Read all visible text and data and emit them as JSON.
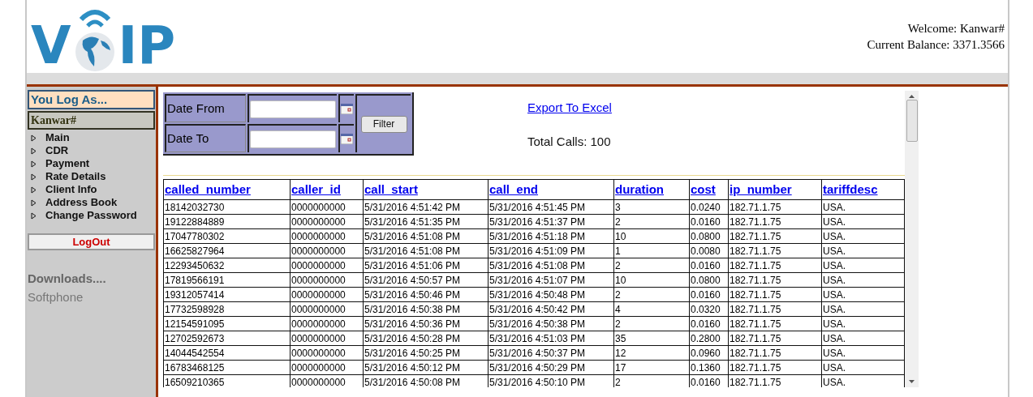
{
  "logo": {
    "left": "V",
    "right": "IP"
  },
  "header": {
    "welcome": "Welcome: Kanwar#",
    "balance": "Current Balance: 3371.3566"
  },
  "sidebar": {
    "title": "You Log As...",
    "user": "Kanwar#",
    "menu": [
      "Main",
      "CDR",
      "Payment",
      "Rate Details",
      "Client Info",
      "Address Book",
      "Change Password"
    ],
    "logout": "LogOut",
    "downloads_title": "Downloads....",
    "downloads": [
      "Softphone"
    ]
  },
  "filter": {
    "date_from_label": "Date From",
    "date_to_label": "Date To",
    "button": "Filter"
  },
  "export_link": "Export To Excel",
  "total_calls": "Total Calls: 100",
  "table": {
    "columns": [
      "called_number",
      "caller_id",
      "call_start",
      "call_end",
      "duration",
      "cost",
      "ip_number",
      "tariffdesc"
    ],
    "rows": [
      [
        "18142032730",
        "0000000000",
        "5/31/2016 4:51:42 PM",
        "5/31/2016 4:51:45 PM",
        "3",
        "0.0240",
        "182.71.1.75",
        "USA."
      ],
      [
        "19122884889",
        "0000000000",
        "5/31/2016 4:51:35 PM",
        "5/31/2016 4:51:37 PM",
        "2",
        "0.0160",
        "182.71.1.75",
        "USA."
      ],
      [
        "17047780302",
        "0000000000",
        "5/31/2016 4:51:08 PM",
        "5/31/2016 4:51:18 PM",
        "10",
        "0.0800",
        "182.71.1.75",
        "USA."
      ],
      [
        "16625827964",
        "0000000000",
        "5/31/2016 4:51:08 PM",
        "5/31/2016 4:51:09 PM",
        "1",
        "0.0080",
        "182.71.1.75",
        "USA."
      ],
      [
        "12293450632",
        "0000000000",
        "5/31/2016 4:51:06 PM",
        "5/31/2016 4:51:08 PM",
        "2",
        "0.0160",
        "182.71.1.75",
        "USA."
      ],
      [
        "17819566191",
        "0000000000",
        "5/31/2016 4:50:57 PM",
        "5/31/2016 4:51:07 PM",
        "10",
        "0.0800",
        "182.71.1.75",
        "USA."
      ],
      [
        "19312057414",
        "0000000000",
        "5/31/2016 4:50:46 PM",
        "5/31/2016 4:50:48 PM",
        "2",
        "0.0160",
        "182.71.1.75",
        "USA."
      ],
      [
        "17732598928",
        "0000000000",
        "5/31/2016 4:50:38 PM",
        "5/31/2016 4:50:42 PM",
        "4",
        "0.0320",
        "182.71.1.75",
        "USA."
      ],
      [
        "12154591095",
        "0000000000",
        "5/31/2016 4:50:36 PM",
        "5/31/2016 4:50:38 PM",
        "2",
        "0.0160",
        "182.71.1.75",
        "USA."
      ],
      [
        "12702592673",
        "0000000000",
        "5/31/2016 4:50:28 PM",
        "5/31/2016 4:51:03 PM",
        "35",
        "0.2800",
        "182.71.1.75",
        "USA."
      ],
      [
        "14044542554",
        "0000000000",
        "5/31/2016 4:50:25 PM",
        "5/31/2016 4:50:37 PM",
        "12",
        "0.0960",
        "182.71.1.75",
        "USA."
      ],
      [
        "16783468125",
        "0000000000",
        "5/31/2016 4:50:12 PM",
        "5/31/2016 4:50:29 PM",
        "17",
        "0.1360",
        "182.71.1.75",
        "USA."
      ],
      [
        "16509210365",
        "0000000000",
        "5/31/2016 4:50:08 PM",
        "5/31/2016 4:50:10 PM",
        "2",
        "0.0160",
        "182.71.1.75",
        "USA."
      ]
    ]
  }
}
